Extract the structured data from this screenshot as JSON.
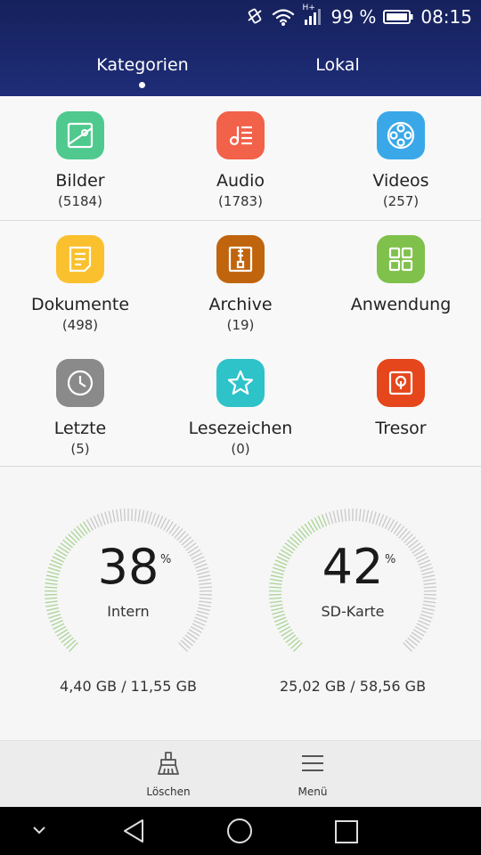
{
  "status_bar": {
    "battery": "99 %",
    "time": "08:15",
    "network": "H+"
  },
  "tabs": [
    {
      "label": "Kategorien",
      "active": true
    },
    {
      "label": "Lokal",
      "active": false
    }
  ],
  "categories": [
    {
      "name": "Bilder",
      "count": "(5184)",
      "icon": "image-icon",
      "color": "#4fc98e"
    },
    {
      "name": "Audio",
      "count": "(1783)",
      "icon": "music-list-icon",
      "color": "#f26149"
    },
    {
      "name": "Videos",
      "count": "(257)",
      "icon": "film-reel-icon",
      "color": "#3aa8e8"
    },
    {
      "name": "Dokumente",
      "count": "(498)",
      "icon": "document-icon",
      "color": "#fbc02d"
    },
    {
      "name": "Archive",
      "count": "(19)",
      "icon": "archive-zip-icon",
      "color": "#c0650d"
    },
    {
      "name": "Anwendung",
      "count": "",
      "icon": "apps-grid-icon",
      "color": "#7fc14b"
    },
    {
      "name": "Letzte",
      "count": "(5)",
      "icon": "clock-icon",
      "color": "#8a8a8a"
    },
    {
      "name": "Lesezeichen",
      "count": "(0)",
      "icon": "star-icon",
      "color": "#2ec2c9"
    },
    {
      "name": "Tresor",
      "count": "",
      "icon": "safe-icon",
      "color": "#e5461b"
    }
  ],
  "storage": [
    {
      "percent": "38",
      "percent_value": 38,
      "label": "Intern",
      "capacity": "4,40 GB / 11,55 GB"
    },
    {
      "percent": "42",
      "percent_value": 42,
      "label": "SD-Karte",
      "capacity": "25,02 GB / 58,56 GB"
    }
  ],
  "storage_percent_sign": "%",
  "toolbar": {
    "clean_label": "Löschen",
    "menu_label": "Menü"
  }
}
